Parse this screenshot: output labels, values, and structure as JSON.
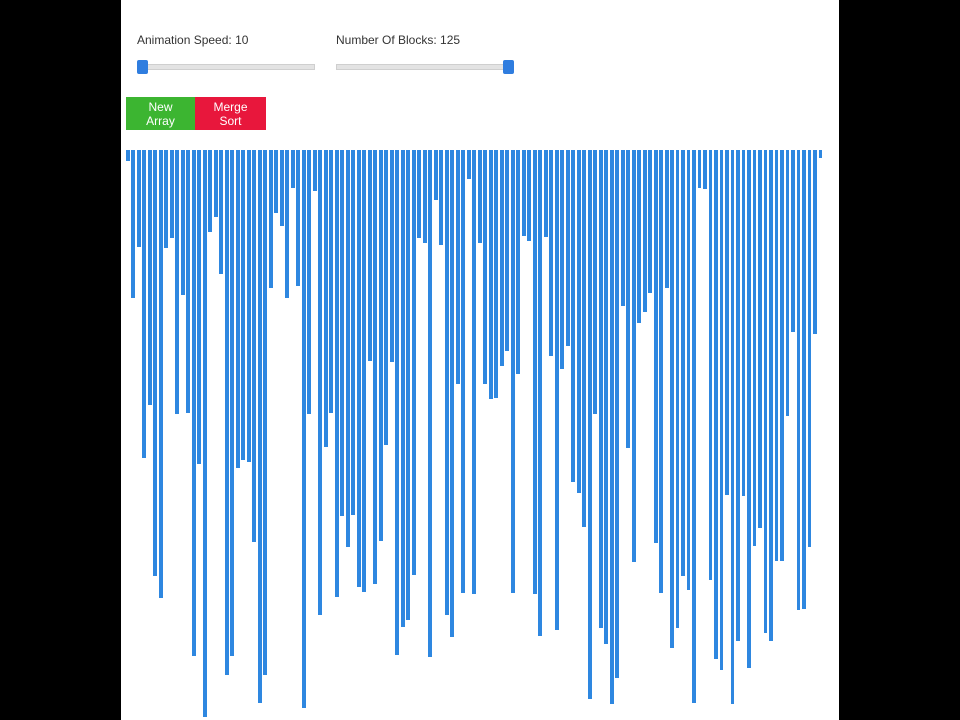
{
  "controls": {
    "speed_label": "Animation Speed: 10",
    "speed_value": 10,
    "speed_min": 10,
    "speed_max": 100,
    "blocks_label": "Number Of Blocks: 125",
    "blocks_value": 125,
    "blocks_max": 125
  },
  "buttons": {
    "new_array": "New Array",
    "merge_sort": "Merge Sort"
  },
  "colors": {
    "bar": "#2e87e0",
    "new_array": "#3cb531",
    "merge_sort": "#e8173c",
    "slider_thumb": "#2f7ddf"
  },
  "chart_data": {
    "type": "bar",
    "max_value": 560,
    "values": [
      11,
      145,
      95,
      303,
      251,
      419,
      440,
      96,
      86,
      259,
      142,
      258,
      497,
      308,
      557,
      81,
      66,
      122,
      516,
      497,
      312,
      305,
      307,
      385,
      543,
      516,
      136,
      62,
      75,
      145,
      37,
      134,
      548,
      259,
      40,
      457,
      292,
      258,
      439,
      360,
      390,
      359,
      429,
      434,
      207,
      426,
      384,
      290,
      208,
      496,
      469,
      462,
      418,
      86,
      91,
      498,
      49,
      93,
      457,
      478,
      230,
      435,
      28,
      436,
      91,
      230,
      245,
      244,
      212,
      197,
      435,
      220,
      84,
      89,
      436,
      477,
      85,
      202,
      472,
      215,
      193,
      326,
      337,
      370,
      539,
      259,
      470,
      485,
      544,
      519,
      153,
      293,
      405,
      170,
      159,
      140,
      386,
      435,
      136,
      489,
      470,
      419,
      432,
      543,
      37,
      38,
      422,
      500,
      511,
      339,
      544,
      482,
      340,
      509,
      389,
      371,
      475,
      482,
      404,
      404,
      261,
      179,
      452,
      451,
      390,
      181,
      8
    ]
  }
}
